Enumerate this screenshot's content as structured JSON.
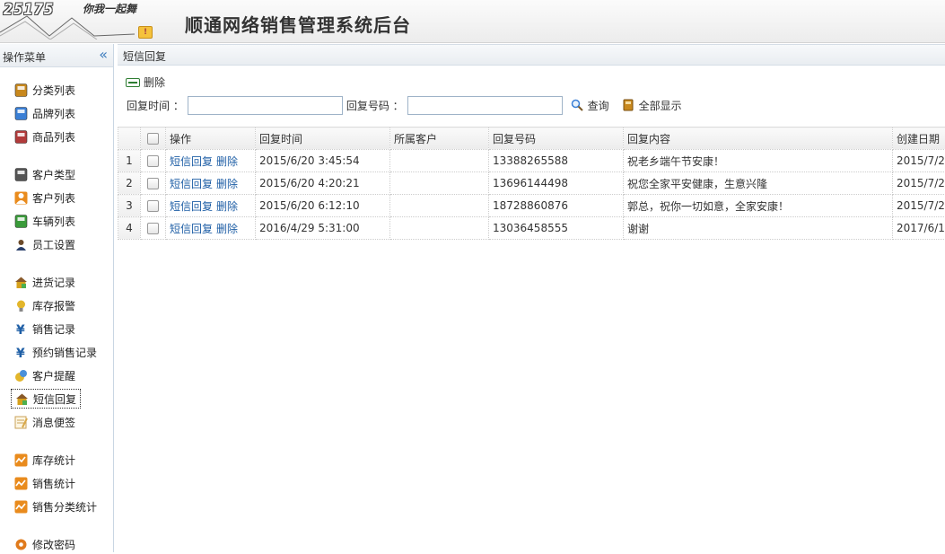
{
  "header": {
    "logo_number": "25175",
    "logo_slogan": "你我一起舞",
    "title": "顺通网络销售管理系统后台"
  },
  "sidebar": {
    "title": "操作菜单",
    "collapse_glyph": "«",
    "items": [
      {
        "label": "分类列表",
        "icon": "category-list-icon",
        "color": "#c8881d"
      },
      {
        "label": "品牌列表",
        "icon": "brand-list-icon",
        "color": "#3a7fd5"
      },
      {
        "label": "商品列表",
        "icon": "product-list-icon",
        "color": "#b23b3b"
      },
      {
        "label": "客户类型",
        "icon": "customer-type-icon",
        "color": "#555555"
      },
      {
        "label": "客户列表",
        "icon": "customer-list-icon",
        "color": "#e98b1d"
      },
      {
        "label": "车辆列表",
        "icon": "vehicle-list-icon",
        "color": "#3a9b3a"
      },
      {
        "label": "员工设置",
        "icon": "employee-icon",
        "color": "#333333"
      },
      {
        "label": "进货记录",
        "icon": "purchase-record-icon",
        "color": "#d6a11c"
      },
      {
        "label": "库存报警",
        "icon": "stock-alarm-icon",
        "color": "#e3b62b"
      },
      {
        "label": "销售记录",
        "icon": "yen-icon",
        "color": "#1f5fa6"
      },
      {
        "label": "预约销售记录",
        "icon": "yen-icon",
        "color": "#1f5fa6"
      },
      {
        "label": "客户提醒",
        "icon": "customer-reminder-icon",
        "color": "#e3b62b"
      },
      {
        "label": "短信回复",
        "icon": "sms-reply-icon",
        "color": "#d6a11c"
      },
      {
        "label": "消息便签",
        "icon": "memo-icon",
        "color": "#d9a94a"
      },
      {
        "label": "库存统计",
        "icon": "chart-icon",
        "color": "#e98b1d"
      },
      {
        "label": "销售统计",
        "icon": "chart-icon",
        "color": "#e98b1d"
      },
      {
        "label": "销售分类统计",
        "icon": "chart-icon",
        "color": "#e98b1d"
      },
      {
        "label": "修改密码",
        "icon": "gear-icon",
        "color": "#e07b1d"
      }
    ],
    "active_index": 12
  },
  "panel": {
    "title": "短信回复",
    "delete_label": "删除",
    "search": {
      "time_label": "回复时间 ：",
      "time_value": "",
      "phone_label": "回复号码 ：",
      "phone_value": "",
      "query_label": "查询",
      "show_all_label": "全部显示"
    }
  },
  "table": {
    "columns": [
      "操作",
      "回复时间",
      "所属客户",
      "回复号码",
      "回复内容",
      "创建日期"
    ],
    "op_reply": "短信回复",
    "op_delete": "删除",
    "rows": [
      {
        "num": "1",
        "time": "2015/6/20 3:45:54",
        "customer": "",
        "phone": "13388265588",
        "content": "祝老乡端午节安康！",
        "created": "2015/7/2"
      },
      {
        "num": "2",
        "time": "2015/6/20 4:20:21",
        "customer": "",
        "phone": "13696144498",
        "content": "祝您全家平安健康，生意兴隆",
        "created": "2015/7/2"
      },
      {
        "num": "3",
        "time": "2015/6/20 6:12:10",
        "customer": "",
        "phone": "18728860876",
        "content": "郭总，祝你一切如意，全家安康！",
        "created": "2015/7/2"
      },
      {
        "num": "4",
        "time": "2016/4/29 5:31:00",
        "customer": "",
        "phone": "13036458555",
        "content": "谢谢",
        "created": "2017/6/1"
      }
    ]
  }
}
